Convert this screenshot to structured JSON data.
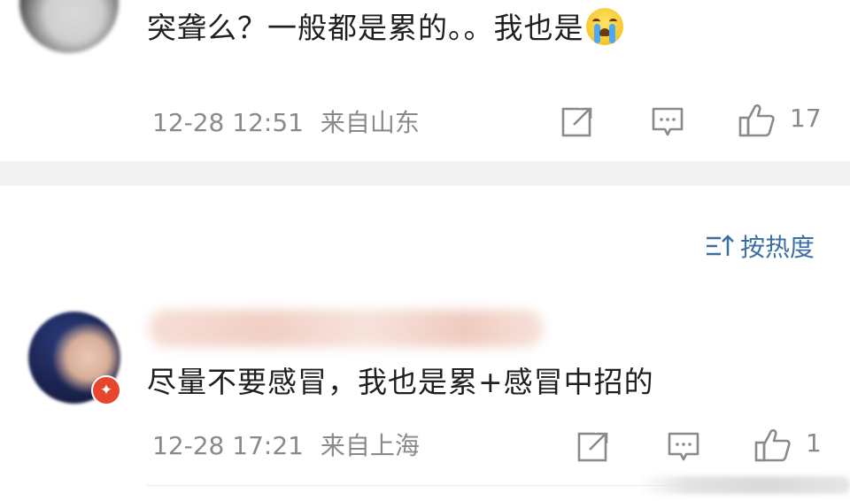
{
  "comments": [
    {
      "text": "突聋么？一般都是累的。。我也是",
      "emoji": "crying-emoji",
      "time": "12-28 12:51",
      "location": "来自山东",
      "likes": "17"
    },
    {
      "text": "尽量不要感冒，我也是累+感冒中招的",
      "time": "12-28 17:21",
      "location": "来自上海",
      "likes": "1"
    }
  ],
  "sort": {
    "label": "按热度",
    "icon": "sort-icon",
    "color": "#3b6fa3"
  },
  "colors": {
    "meta": "#8a8a8a",
    "text": "#1f1f1f",
    "separator": "#f2f2f2",
    "badge": "#e8452e"
  }
}
